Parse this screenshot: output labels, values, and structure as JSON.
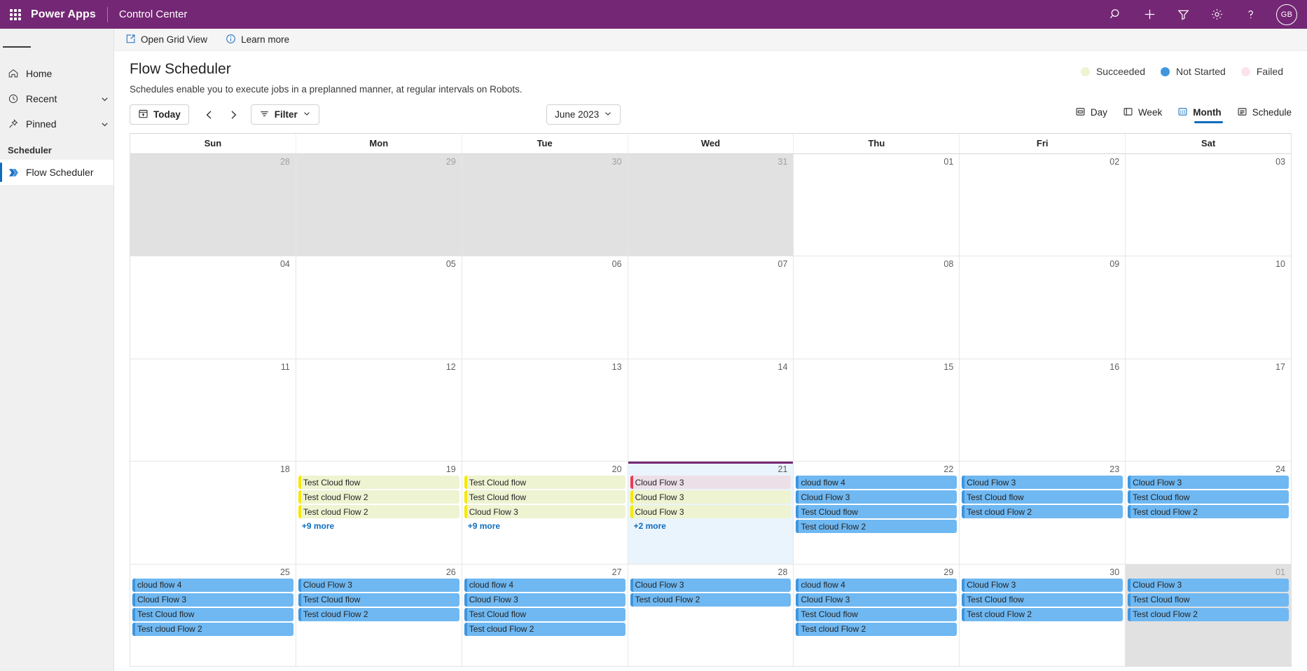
{
  "topbar": {
    "waffle_label": "app-launcher",
    "brand": "Power Apps",
    "app_name": "Control Center",
    "icons": [
      "search-icon",
      "add-icon",
      "filter-icon",
      "gear-icon",
      "help-icon"
    ],
    "avatar_initials": "GB"
  },
  "sidebar": {
    "hamburger_label": "menu",
    "items": [
      {
        "label": "Home",
        "icon": "home-icon",
        "chevron": false
      },
      {
        "label": "Recent",
        "icon": "clock-icon",
        "chevron": true
      },
      {
        "label": "Pinned",
        "icon": "pin-icon",
        "chevron": true
      }
    ],
    "group_label": "Scheduler",
    "selected_item": {
      "label": "Flow Scheduler",
      "icon": "flow-icon"
    }
  },
  "commandbar": {
    "open_grid_view": "Open Grid View",
    "learn_more": "Learn more"
  },
  "page": {
    "title": "Flow Scheduler",
    "subtitle": "Schedules enable you to execute jobs in a preplanned manner, at regular intervals on Robots."
  },
  "legend": [
    {
      "label": "Succeeded",
      "color": "#eef3d2"
    },
    {
      "label": "Not Started",
      "color": "#3f96de"
    },
    {
      "label": "Failed",
      "color": "#fbe4e8"
    }
  ],
  "toolbar": {
    "today_label": "Today",
    "prev_label": "previous",
    "next_label": "next",
    "filter_label": "Filter",
    "month_label": "June 2023",
    "views": [
      {
        "label": "Day",
        "active": false
      },
      {
        "label": "Week",
        "active": false
      },
      {
        "label": "Month",
        "active": true
      },
      {
        "label": "Schedule",
        "active": false
      }
    ]
  },
  "calendar": {
    "day_names": [
      "Sun",
      "Mon",
      "Tue",
      "Wed",
      "Thu",
      "Fri",
      "Sat"
    ],
    "today": 21,
    "weeks": [
      [
        {
          "num": "28",
          "other": true,
          "events": []
        },
        {
          "num": "29",
          "other": true,
          "events": []
        },
        {
          "num": "30",
          "other": true,
          "events": []
        },
        {
          "num": "31",
          "other": true,
          "events": []
        },
        {
          "num": "01",
          "other": false,
          "events": []
        },
        {
          "num": "02",
          "other": false,
          "events": []
        },
        {
          "num": "03",
          "other": false,
          "events": []
        }
      ],
      [
        {
          "num": "04",
          "other": false,
          "events": []
        },
        {
          "num": "05",
          "other": false,
          "events": []
        },
        {
          "num": "06",
          "other": false,
          "events": []
        },
        {
          "num": "07",
          "other": false,
          "events": []
        },
        {
          "num": "08",
          "other": false,
          "events": []
        },
        {
          "num": "09",
          "other": false,
          "events": []
        },
        {
          "num": "10",
          "other": false,
          "events": []
        }
      ],
      [
        {
          "num": "11",
          "other": false,
          "events": []
        },
        {
          "num": "12",
          "other": false,
          "events": []
        },
        {
          "num": "13",
          "other": false,
          "events": []
        },
        {
          "num": "14",
          "other": false,
          "events": []
        },
        {
          "num": "15",
          "other": false,
          "events": []
        },
        {
          "num": "16",
          "other": false,
          "events": []
        },
        {
          "num": "17",
          "other": false,
          "events": []
        }
      ],
      [
        {
          "num": "18",
          "other": false,
          "events": []
        },
        {
          "num": "19",
          "other": false,
          "more": "+9 more",
          "events": [
            {
              "title": "Test Cloud flow",
              "status": "succeeded"
            },
            {
              "title": "Test cloud Flow 2",
              "status": "succeeded"
            },
            {
              "title": "Test cloud Flow 2",
              "status": "succeeded"
            }
          ]
        },
        {
          "num": "20",
          "other": false,
          "more": "+9 more",
          "events": [
            {
              "title": "Test Cloud flow",
              "status": "succeeded"
            },
            {
              "title": "Test Cloud flow",
              "status": "succeeded"
            },
            {
              "title": "Cloud Flow 3",
              "status": "succeeded"
            }
          ]
        },
        {
          "num": "21",
          "other": false,
          "today": true,
          "more": "+2 more",
          "events": [
            {
              "title": "Cloud Flow 3",
              "status": "failed"
            },
            {
              "title": "Cloud Flow 3",
              "status": "succeeded"
            },
            {
              "title": "Cloud Flow 3",
              "status": "succeeded"
            }
          ]
        },
        {
          "num": "22",
          "other": false,
          "events": [
            {
              "title": "cloud flow 4",
              "status": "notstarted"
            },
            {
              "title": "Cloud Flow 3",
              "status": "notstarted"
            },
            {
              "title": "Test Cloud flow",
              "status": "notstarted"
            },
            {
              "title": "Test cloud Flow 2",
              "status": "notstarted"
            }
          ]
        },
        {
          "num": "23",
          "other": false,
          "events": [
            {
              "title": "Cloud Flow 3",
              "status": "notstarted"
            },
            {
              "title": "Test Cloud flow",
              "status": "notstarted"
            },
            {
              "title": "Test cloud Flow 2",
              "status": "notstarted"
            }
          ]
        },
        {
          "num": "24",
          "other": false,
          "events": [
            {
              "title": "Cloud Flow 3",
              "status": "notstarted"
            },
            {
              "title": "Test Cloud flow",
              "status": "notstarted"
            },
            {
              "title": "Test cloud Flow 2",
              "status": "notstarted"
            }
          ]
        }
      ],
      [
        {
          "num": "25",
          "other": false,
          "events": [
            {
              "title": "cloud flow 4",
              "status": "notstarted"
            },
            {
              "title": "Cloud Flow 3",
              "status": "notstarted"
            },
            {
              "title": "Test Cloud flow",
              "status": "notstarted"
            },
            {
              "title": "Test cloud Flow 2",
              "status": "notstarted"
            }
          ]
        },
        {
          "num": "26",
          "other": false,
          "events": [
            {
              "title": "Cloud Flow 3",
              "status": "notstarted"
            },
            {
              "title": "Test Cloud flow",
              "status": "notstarted"
            },
            {
              "title": "Test cloud Flow 2",
              "status": "notstarted"
            }
          ]
        },
        {
          "num": "27",
          "other": false,
          "events": [
            {
              "title": "cloud flow 4",
              "status": "notstarted"
            },
            {
              "title": "Cloud Flow 3",
              "status": "notstarted"
            },
            {
              "title": "Test Cloud flow",
              "status": "notstarted"
            },
            {
              "title": "Test cloud Flow 2",
              "status": "notstarted"
            }
          ]
        },
        {
          "num": "28",
          "other": false,
          "events": [
            {
              "title": "Cloud Flow 3",
              "status": "notstarted"
            },
            {
              "title": "Test cloud Flow 2",
              "status": "notstarted"
            }
          ]
        },
        {
          "num": "29",
          "other": false,
          "events": [
            {
              "title": "cloud flow 4",
              "status": "notstarted"
            },
            {
              "title": "Cloud Flow 3",
              "status": "notstarted"
            },
            {
              "title": "Test Cloud flow",
              "status": "notstarted"
            },
            {
              "title": "Test cloud Flow 2",
              "status": "notstarted"
            }
          ]
        },
        {
          "num": "30",
          "other": false,
          "events": [
            {
              "title": "Cloud Flow 3",
              "status": "notstarted"
            },
            {
              "title": "Test Cloud flow",
              "status": "notstarted"
            },
            {
              "title": "Test cloud Flow 2",
              "status": "notstarted"
            }
          ]
        },
        {
          "num": "01",
          "other": true,
          "events": [
            {
              "title": "Cloud Flow 3",
              "status": "notstarted"
            },
            {
              "title": "Test Cloud flow",
              "status": "notstarted"
            },
            {
              "title": "Test cloud Flow 2",
              "status": "notstarted"
            }
          ]
        }
      ]
    ]
  }
}
